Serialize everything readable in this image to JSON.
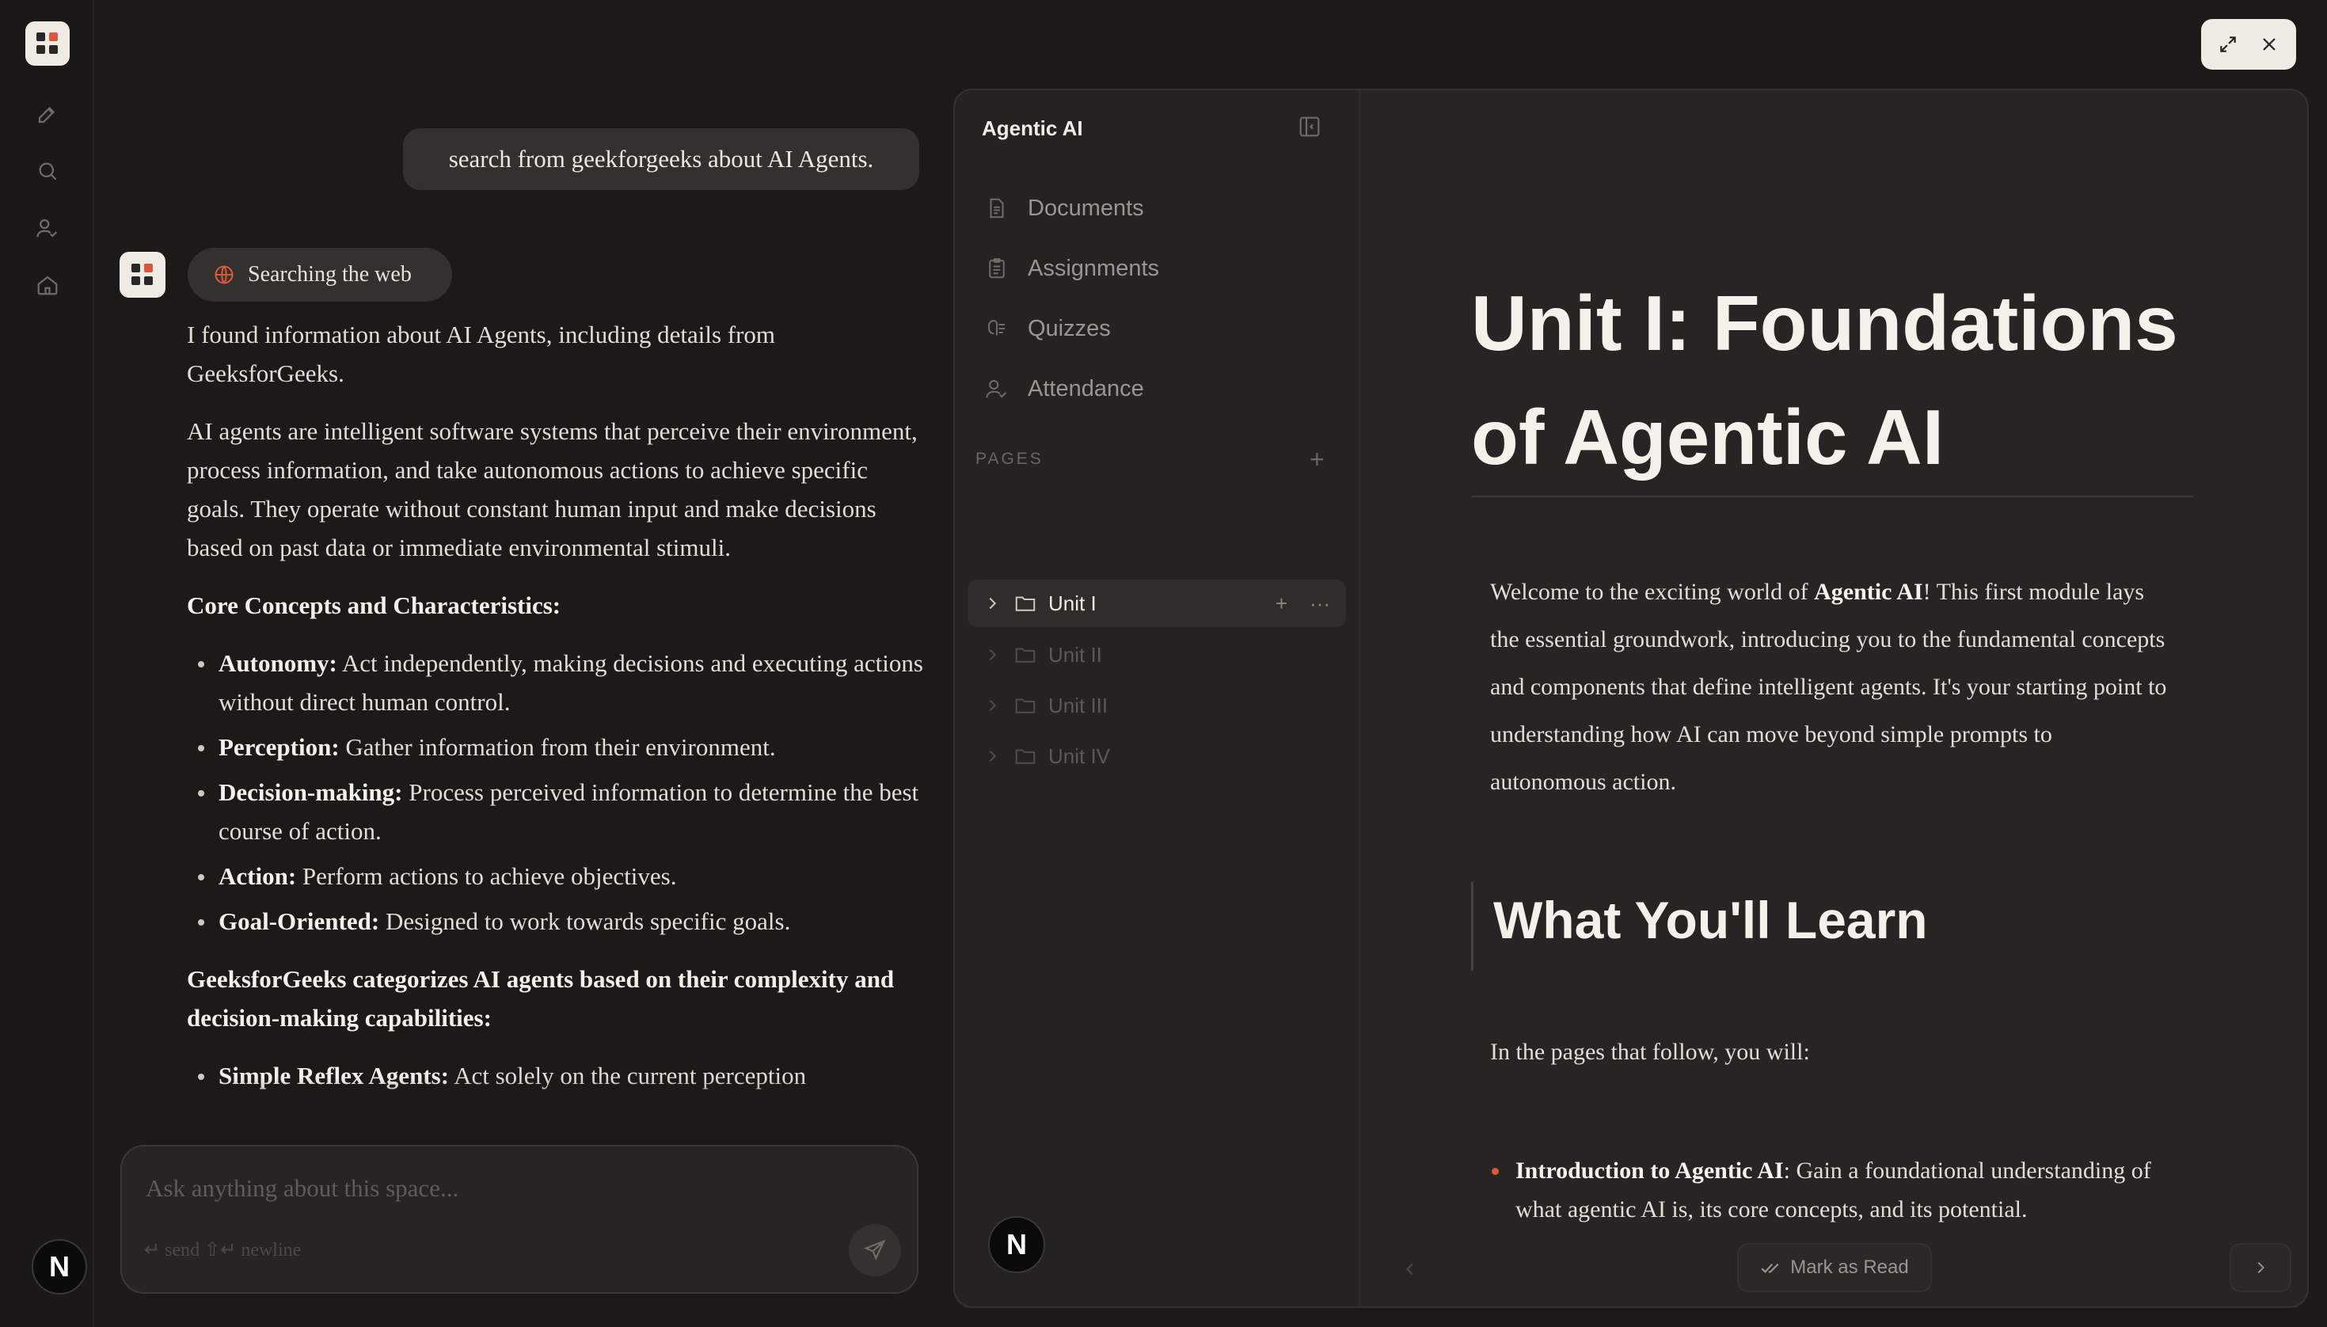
{
  "chat": {
    "user_message": "search from geekforgeeks about AI Agents.",
    "status_pill": "Searching the web",
    "answer": {
      "p1": "I found information about AI Agents, including details from GeeksforGeeks.",
      "p2": "AI agents are intelligent software systems that perceive their environment, process information, and take autonomous actions to achieve specific goals. They operate without constant human input and make decisions based on past data or immediate environmental stimuli.",
      "core_heading": "Core Concepts and Characteristics:",
      "core_items": [
        {
          "term": "Autonomy:",
          "text": " Act independently, making decisions and executing actions without direct human control."
        },
        {
          "term": "Perception:",
          "text": " Gather information from their environment."
        },
        {
          "term": "Decision-making:",
          "text": " Process perceived information to determine the best course of action."
        },
        {
          "term": "Action:",
          "text": " Perform actions to achieve objectives."
        },
        {
          "term": "Goal-Oriented:",
          "text": " Designed to work towards specific goals."
        }
      ],
      "gfg_heading": "GeeksforGeeks categorizes AI agents based on their complexity and decision-making capabilities:",
      "gfg_items": [
        {
          "term": "Simple Reflex Agents:",
          "text": " Act solely on the current perception"
        }
      ]
    },
    "composer": {
      "placeholder": "Ask anything about this space...",
      "hint": "↵ send ⇧↵ newline"
    }
  },
  "rail": {
    "avatar_letter": "N"
  },
  "panel": {
    "space_title": "Agentic AI",
    "nav": [
      {
        "label": "Documents",
        "icon": "document-icon"
      },
      {
        "label": "Assignments",
        "icon": "clipboard-icon"
      },
      {
        "label": "Quizzes",
        "icon": "quiz-icon"
      },
      {
        "label": "Attendance",
        "icon": "user-check-icon"
      }
    ],
    "pages_label": "PAGES",
    "pages": [
      {
        "label": "Unit I",
        "active": true
      },
      {
        "label": "Unit II",
        "active": false
      },
      {
        "label": "Unit III",
        "active": false
      },
      {
        "label": "Unit IV",
        "active": false
      }
    ],
    "avatar_letter": "N"
  },
  "content": {
    "title": "Unit I: Foundations of Agentic AI",
    "intro_pre": "Welcome to the exciting world of ",
    "intro_bold": "Agentic AI",
    "intro_post": "! This first module lays the essential groundwork, introducing you to the fundamental concepts and components that define intelligent agents. It's your starting point to understanding how AI can move beyond simple prompts to autonomous action.",
    "section_heading": "What You'll Learn",
    "lead": "In the pages that follow, you will:",
    "bullet_term": "Introduction to Agentic AI",
    "bullet_text": ": Gain a foundational understanding of what agentic AI is, its core concepts, and its potential.",
    "mark_read": "Mark as Read"
  },
  "colors": {
    "accent": "#d9583a",
    "background": "#1b1a18",
    "panel": "#262523"
  }
}
